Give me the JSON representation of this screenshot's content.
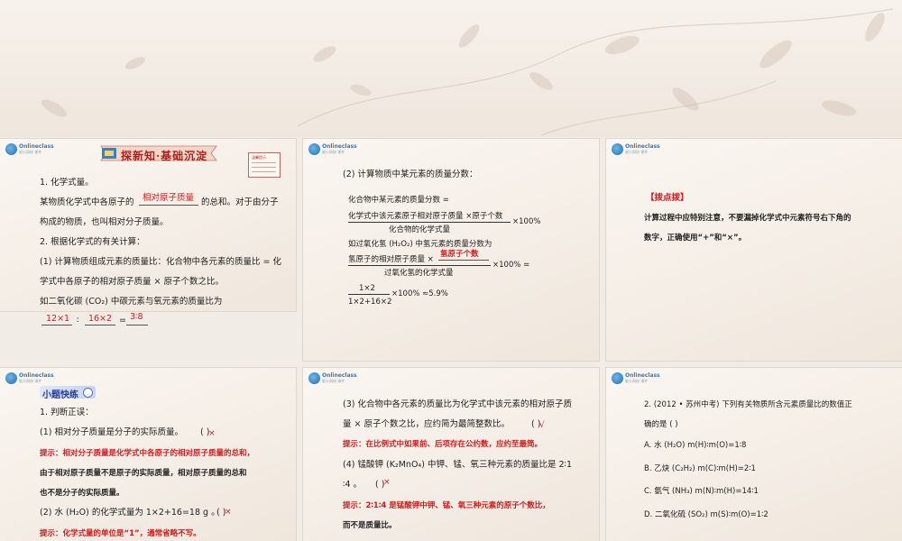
{
  "logo": {
    "brand": "Onlineclass",
    "sub": "星火网校 课件"
  },
  "slide1": {
    "title": "探新知·基础沉淀",
    "note_label": "温馨提示",
    "l1": "1. 化学式量。",
    "l2a": "某物质化学式中各原子的",
    "l2_fill": "相对原子质量",
    "l2b": "的总和。对于由分子",
    "l3": "构成的物质，也叫相对分子质量。",
    "l4": "2. 根据化学式的有关计算：",
    "l5": "(1) 计算物质组成元素的质量比：化合物中各元素的质量比 = 化",
    "l6": "学式中各原子的相对原子质量 × 原子个数之比。",
    "l7": "如二氧化碳 (CO₂) 中碳元素与氧元素的质量比为",
    "f1": "12×1",
    "f2": "16×2",
    "f3": "3∶8",
    "colon": "∶",
    "eq": "="
  },
  "slide2": {
    "l1": "(2) 计算物质中某元素的质量分数：",
    "l2": "化合物中某元素的质量分数 =",
    "num1": "化学式中该元素原子相对原子质量 ×原子个数",
    "den1": "化合物的化学式量",
    "pct1": "×100%",
    "l3": "如过氧化氢 (H₂O₂) 中氢元素的质量分数为",
    "num2a": "氢原子的相对原子质量 ×",
    "num2_fill": "氢原子个数",
    "den2": "过氧化氢的化学式量",
    "pct2": "×100% =",
    "num3": "1×2",
    "den3": "1×2+16×2",
    "pct3": "×100% ≈5.9%"
  },
  "slide3": {
    "heading": "【拨点拨】",
    "l1": "计算过程中应特别注意，不要漏掉化学式中元素符号右下角的",
    "l2": "数字，正确使用“+”和“×”。"
  },
  "slide4": {
    "tag": "小题快练",
    "l1": "1. 判断正误：",
    "l2": "(1) 相对分子质量是分子的实际质量。",
    "m2": "×",
    "paren": "(   )",
    "h1": "提示：相对分子质量是化学式中各原子的相对原子质量的总和，",
    "h2": "由于相对原子质量不是原子的实际质量，相对原子质量的总和",
    "h3": "也不是分子的实际质量。",
    "l3": "(2) 水 (H₂O) 的化学式量为 1×2+16=18 g 。",
    "m3": "×",
    "h4": "提示：化学式量的单位是“1”，通常省略不写。"
  },
  "slide5": {
    "l1": "(3) 化合物中各元素的质量比为化学式中该元素的相对原子质",
    "l2": "量 × 原子个数之比，应约简为最简整数比。",
    "m1": "√",
    "paren": "(   )",
    "h1": "提示：在比例式中如果前、后项存在公约数，应约至最简。",
    "l3": "(4) 锰酸钾 (K₂MnO₄) 中钾、锰、氧三种元素的质量比是 2∶1",
    "l4": "∶4 。",
    "m2": "×",
    "h2": "提示：2∶1∶4 是锰酸钾中钾、锰、氧三种元素的原子个数比，",
    "h3": "而不是质量比。"
  },
  "slide6": {
    "l1": "2. (2012 • 苏州中考) 下列有关物质所含元素质量比的数值正",
    "l2": "确的是 (     )",
    "a": "A. 水 (H₂O)      m(H)∶m(O)=1∶8",
    "b": "B. 乙炔 (C₂H₂)      m(C)∶m(H)=2∶1",
    "c": "C. 氨气 (NH₃)      m(N)∶m(H)=14∶1",
    "d": "D. 二氧化硫 (SO₂)      m(S)∶m(O)=1∶2"
  }
}
